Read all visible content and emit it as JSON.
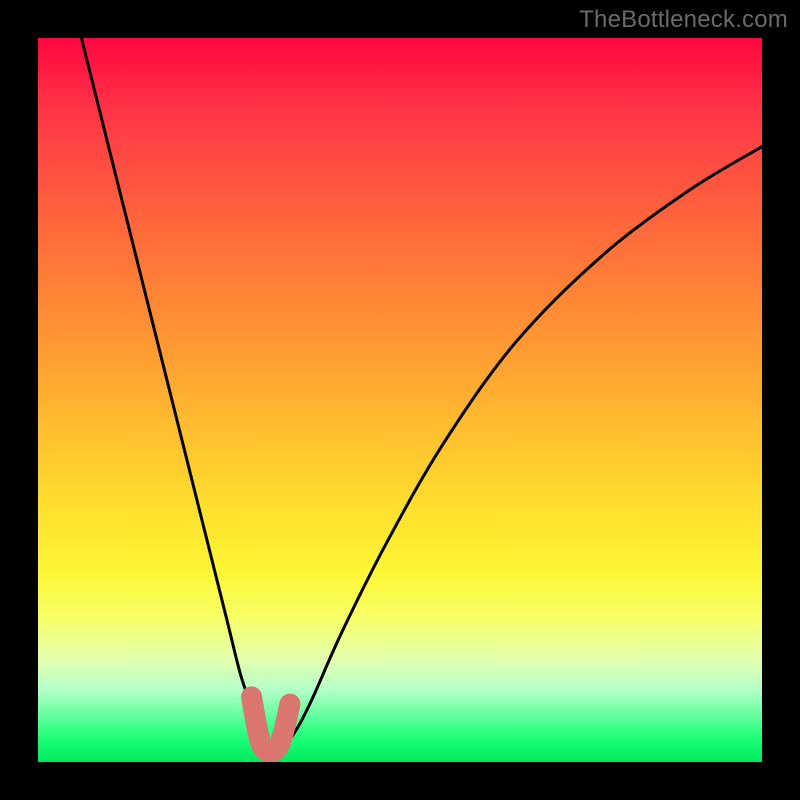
{
  "watermark": "TheBottleneck.com",
  "chart_data": {
    "type": "line",
    "title": "",
    "xlabel": "",
    "ylabel": "",
    "xlim": [
      0,
      100
    ],
    "ylim": [
      0,
      100
    ],
    "series": [
      {
        "name": "bottleneck-curve",
        "x": [
          6,
          10,
          14,
          18,
          22,
          26,
          28,
          30,
          30.5,
          31.5,
          33,
          34,
          36,
          38,
          42,
          48,
          56,
          66,
          78,
          90,
          100
        ],
        "values": [
          100,
          84,
          68,
          52,
          36,
          20,
          12,
          6,
          2,
          1,
          1,
          2,
          5,
          9,
          18,
          30,
          44,
          58,
          70,
          79,
          85
        ]
      },
      {
        "name": "highlight-band",
        "x": [
          29.5,
          30.2,
          30.8,
          31.6,
          32.6,
          33.4,
          34.0,
          34.8
        ],
        "values": [
          9.0,
          5.0,
          2.5,
          1.5,
          1.5,
          2.5,
          4.5,
          8.0
        ]
      }
    ],
    "gradient_stops": [
      {
        "pos": 0,
        "color": "#ff063f"
      },
      {
        "pos": 10,
        "color": "#ff3547"
      },
      {
        "pos": 22,
        "color": "#ff5b3e"
      },
      {
        "pos": 34,
        "color": "#ff8036"
      },
      {
        "pos": 46,
        "color": "#ffa431"
      },
      {
        "pos": 56,
        "color": "#ffc42e"
      },
      {
        "pos": 66,
        "color": "#ffe22e"
      },
      {
        "pos": 74,
        "color": "#fcf635"
      },
      {
        "pos": 80,
        "color": "#f7ff66"
      },
      {
        "pos": 86,
        "color": "#e2ffb0"
      },
      {
        "pos": 90,
        "color": "#b3ffc9"
      },
      {
        "pos": 94,
        "color": "#5bff9a"
      },
      {
        "pos": 97,
        "color": "#17ff74"
      },
      {
        "pos": 100,
        "color": "#04e85e"
      }
    ],
    "colors": {
      "curve": "#000000",
      "highlight": "#d9766f",
      "background_frame": "#000000"
    }
  }
}
